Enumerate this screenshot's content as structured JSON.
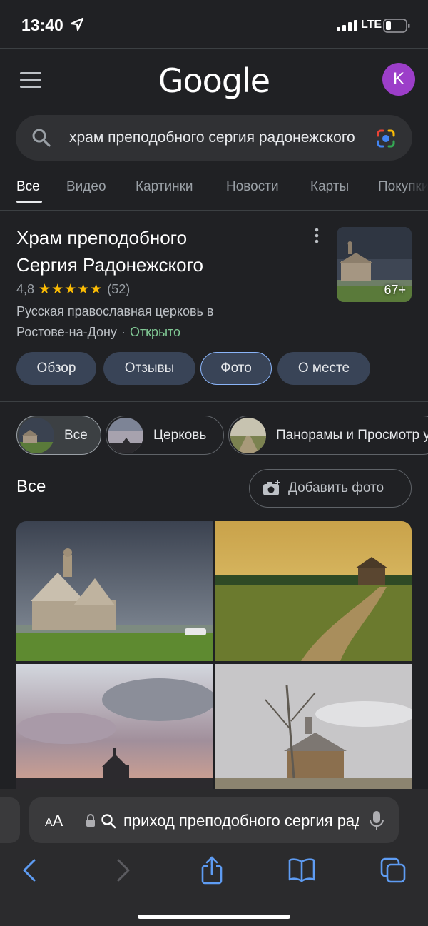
{
  "status_bar": {
    "time": "13:40",
    "network": "LTE"
  },
  "header": {
    "logo": "Google",
    "avatar_letter": "K"
  },
  "search": {
    "query": "храм преподобного сергия радонежского"
  },
  "tabs": [
    "Все",
    "Видео",
    "Картинки",
    "Новости",
    "Карты",
    "Покупки"
  ],
  "place": {
    "title_line1": "Храм преподобного",
    "title_line2": "Сергия Радонежского",
    "rating": "4,8",
    "stars": "★★★★★",
    "reviews": "(52)",
    "type_line1": "Русская православная церковь в",
    "city": "Ростове-на-Дону",
    "separator": "·",
    "status": "Открыто",
    "photo_count": "67+",
    "buttons": [
      "Обзор",
      "Отзывы",
      "Фото",
      "О месте"
    ]
  },
  "photo_chips": [
    "Все",
    "Церковь",
    "Панорамы и Просмотр улиц"
  ],
  "photos_section": {
    "title": "Все",
    "add_photo": "Добавить фото"
  },
  "safari": {
    "aa_small": "A",
    "aa_big": "A",
    "address": "приход преподобного сергия радонежского"
  },
  "colors": {
    "background": "#202124",
    "accent": "#8ab4f8",
    "open": "#81c995",
    "star": "#fbbc04",
    "avatar": "#9c3ec9"
  }
}
